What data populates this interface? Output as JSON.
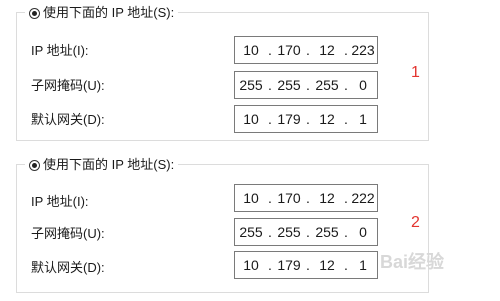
{
  "groups": [
    {
      "legend": "使用下面的 IP 地址(S):",
      "rows": [
        {
          "label": "IP 地址(I):",
          "octets": [
            "10",
            "170",
            "12",
            "223"
          ]
        },
        {
          "label": "子网掩码(U):",
          "octets": [
            "255",
            "255",
            "255",
            "0"
          ]
        },
        {
          "label": "默认网关(D):",
          "octets": [
            "10",
            "179",
            "12",
            "1"
          ]
        }
      ],
      "marker": "1"
    },
    {
      "legend": "使用下面的 IP 地址(S):",
      "rows": [
        {
          "label": "IP 地址(I):",
          "octets": [
            "10",
            "170",
            "12",
            "222"
          ]
        },
        {
          "label": "子网掩码(U):",
          "octets": [
            "255",
            "255",
            "255",
            "0"
          ]
        },
        {
          "label": "默认网关(D):",
          "octets": [
            "10",
            "179",
            "12",
            "1"
          ]
        }
      ],
      "marker": "2"
    }
  ],
  "separator": ".",
  "watermark": "Bai经验",
  "colors": {
    "marker": "#e3342f",
    "border": "#dcdcdc"
  }
}
